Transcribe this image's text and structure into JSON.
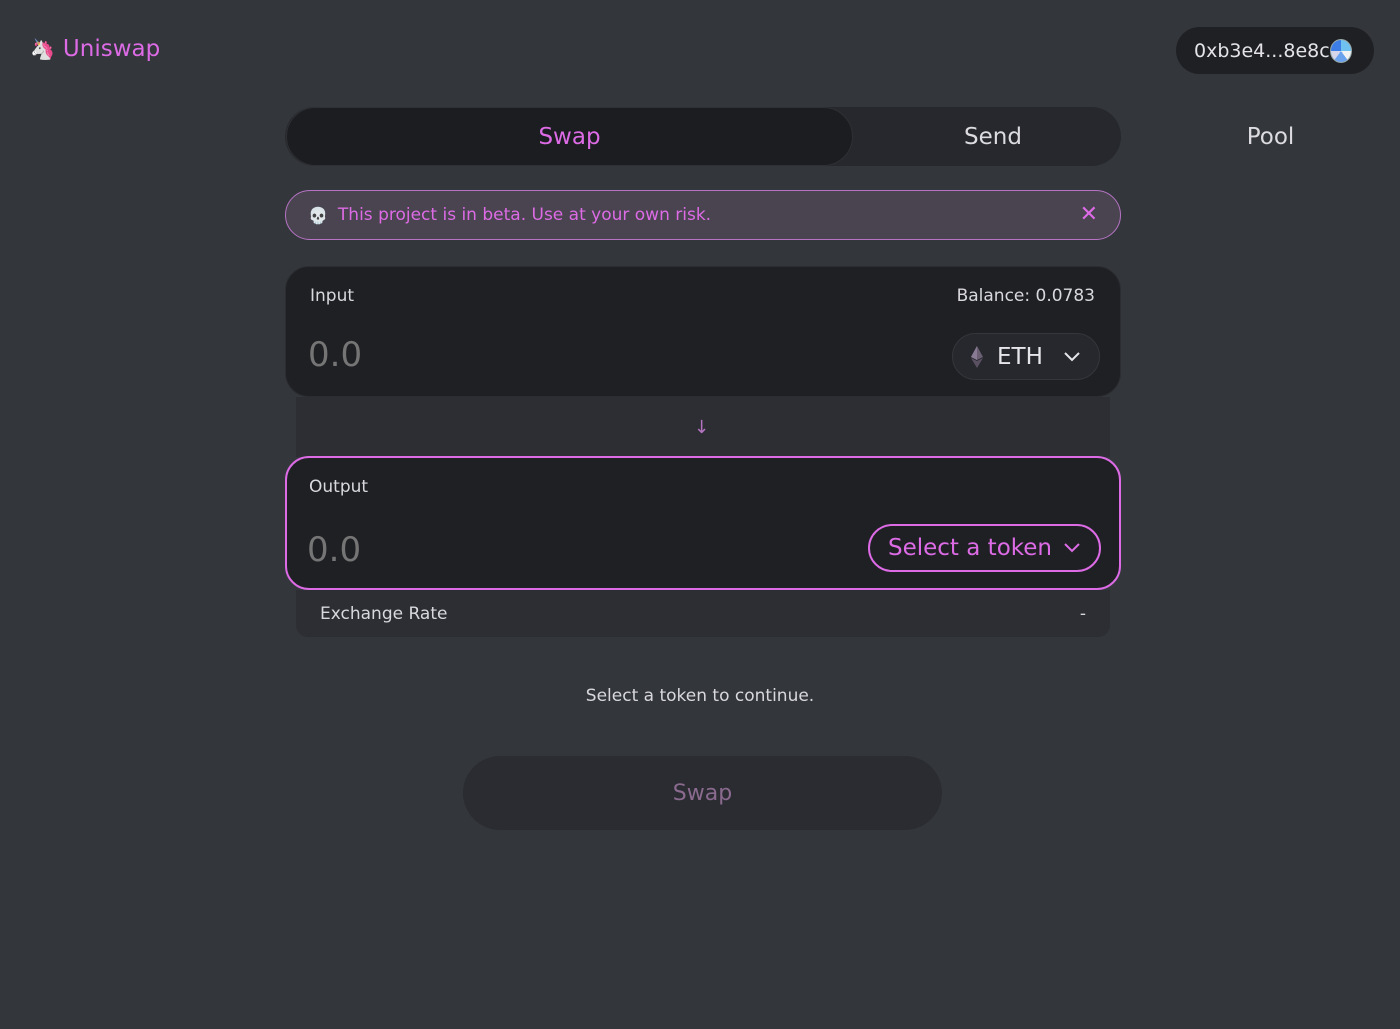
{
  "header": {
    "logo_emoji": "🦄",
    "logo_text": "Uniswap",
    "wallet_address": "0xb3e4...8e8c"
  },
  "tabs": [
    {
      "label": "Swap",
      "active": true
    },
    {
      "label": "Send",
      "active": false
    },
    {
      "label": "Pool",
      "active": false
    }
  ],
  "beta_banner": {
    "icon": "💀",
    "text": "This project is in beta. Use at your own risk.",
    "close_symbol": "✕"
  },
  "input": {
    "label": "Input",
    "balance": "Balance: 0.0783",
    "placeholder": "0.0",
    "token": "ETH"
  },
  "arrow_symbol": "↓",
  "output": {
    "label": "Output",
    "placeholder": "0.0",
    "token_button": "Select a token"
  },
  "exchange_rate": {
    "label": "Exchange Rate",
    "value": "-"
  },
  "hint": "Select a token to continue.",
  "swap_button": "Swap",
  "colors": {
    "accent": "#dc6be5",
    "background": "#33363b",
    "panel": "#1f2024"
  }
}
